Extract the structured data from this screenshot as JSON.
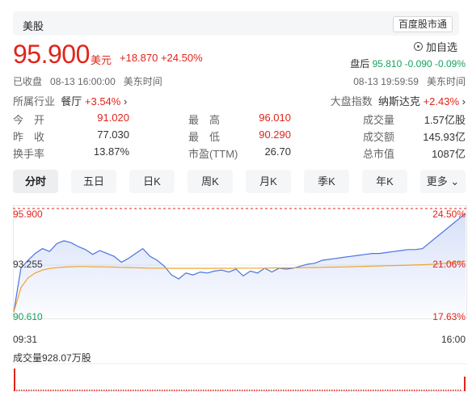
{
  "header": {
    "tab_label": "美股",
    "source_badge": "百度股市通"
  },
  "quote": {
    "price": "95.900",
    "currency": "美元",
    "change": "+18.870 +24.50%",
    "watch_label": "加自选",
    "after_hours_label": "盘后",
    "after_hours_value": "95.810 -0.090 -0.09%",
    "status": "已收盘",
    "close_time": "08-13 16:00:00",
    "timezone": "美东时间",
    "after_hours_time": "08-13 19:59:59",
    "after_hours_tz": "美东时间"
  },
  "industry": {
    "label": "所属行业",
    "name": "餐厅",
    "change": "+3.54%",
    "chevron": "›"
  },
  "market_index": {
    "label": "大盘指数",
    "name": "纳斯达克",
    "change": "+2.43%",
    "chevron": "›"
  },
  "stats": {
    "open_label": "今　开",
    "open": "91.020",
    "prev_label": "昨　收",
    "prev": "77.030",
    "turnover_label": "换手率",
    "turnover": "13.87%",
    "high_label": "最　高",
    "high": "96.010",
    "low_label": "最　低",
    "low": "90.290",
    "pe_label": "市盈(TTM)",
    "pe": "26.70",
    "volume_label": "成交量",
    "volume": "1.57亿股",
    "amount_label": "成交额",
    "amount": "145.93亿",
    "mcap_label": "总市值",
    "mcap": "1087亿"
  },
  "periods": [
    "分时",
    "五日",
    "日K",
    "周K",
    "月K",
    "季K",
    "年K",
    "更多"
  ],
  "more_chevron": "⌄",
  "chart": {
    "price_top": "95.900",
    "price_mid": "93.255",
    "price_bottom": "90.610",
    "pct_top": "24.50%",
    "pct_mid": "21.06%",
    "pct_bottom": "17.63%",
    "time_start": "09:31",
    "time_end": "16:00",
    "volume_label": "成交量928.07万股",
    "colors": {
      "price_line": "#4a74e0",
      "avg_line": "#f0a32b",
      "volume": "#e2231a",
      "ref_line": "#e2231a"
    }
  },
  "chart_data": {
    "type": "line",
    "x_range": [
      "09:31",
      "16:00"
    ],
    "ylim": [
      90.61,
      95.9
    ],
    "pct_range": [
      "17.63%",
      "24.50%"
    ],
    "series": [
      {
        "values": [
          90.85,
          93.1,
          93.5,
          93.85,
          94.1,
          93.95,
          94.35,
          94.5,
          94.4,
          94.2,
          94.05,
          93.8,
          94.0,
          93.85,
          93.7,
          93.4,
          93.6,
          93.85,
          94.1,
          93.7,
          93.5,
          93.2,
          92.75,
          92.55,
          92.85,
          92.75,
          92.9,
          92.85,
          92.95,
          93.0,
          92.9,
          93.05,
          92.7,
          92.95,
          92.85,
          93.1,
          92.9,
          93.1,
          93.05,
          93.1,
          93.2,
          93.3,
          93.35,
          93.5,
          93.55,
          93.6,
          93.65,
          93.7,
          93.75,
          93.8,
          93.85,
          93.85,
          93.9,
          93.95,
          94.0,
          94.05,
          94.05,
          94.1,
          94.4,
          94.7,
          95.0,
          95.3,
          95.6,
          95.9
        ]
      },
      {
        "values": [
          90.85,
          92.1,
          92.6,
          92.85,
          93.0,
          93.08,
          93.12,
          93.15,
          93.17,
          93.18,
          93.18,
          93.17,
          93.17,
          93.16,
          93.15,
          93.14,
          93.13,
          93.12,
          93.11,
          93.1,
          93.1,
          93.1,
          93.09,
          93.09,
          93.09,
          93.09,
          93.09,
          93.09,
          93.09,
          93.09,
          93.09,
          93.1,
          93.1,
          93.1,
          93.1,
          93.1,
          93.11,
          93.11,
          93.11,
          93.12,
          93.12,
          93.13,
          93.13,
          93.14,
          93.15,
          93.15,
          93.16,
          93.17,
          93.18,
          93.19,
          93.2,
          93.21,
          93.22,
          93.23,
          93.24,
          93.25,
          93.26,
          93.27,
          93.29,
          93.31,
          93.34,
          93.38,
          93.42,
          93.46
        ]
      }
    ]
  }
}
